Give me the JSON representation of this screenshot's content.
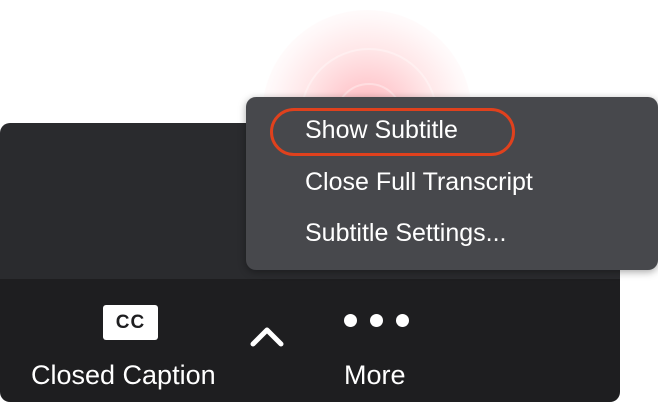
{
  "menu": {
    "items": [
      {
        "label": "Show Subtitle"
      },
      {
        "label": "Close Full Transcript"
      },
      {
        "label": "Subtitle Settings..."
      }
    ],
    "highlight_color": "#e0411d"
  },
  "toolbar": {
    "closed_caption": {
      "badge": "CC",
      "label": "Closed Caption",
      "icon": "cc-icon"
    },
    "expand": {
      "icon": "chevron-up-icon"
    },
    "more": {
      "label": "More",
      "icon": "more-dots-icon"
    }
  },
  "colors": {
    "toolbar_bg": "#1e1e20",
    "menu_bg": "#47484c",
    "click_indicator": "#ff7882"
  }
}
